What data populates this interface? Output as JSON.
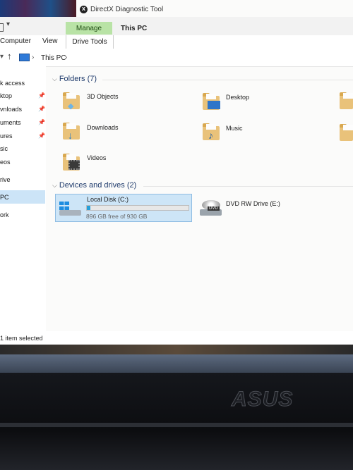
{
  "window": {
    "title": "DirectX Diagnostic Tool",
    "context_title": "This PC"
  },
  "ribbon": {
    "manage_tab": "Manage",
    "tabs": [
      "Computer",
      "View",
      "Drive Tools"
    ]
  },
  "address": {
    "breadcrumb": "This PC"
  },
  "nav_pane": {
    "items": [
      {
        "label": "k access",
        "pinned": false
      },
      {
        "label": "ktop",
        "pinned": true
      },
      {
        "label": "vnloads",
        "pinned": true
      },
      {
        "label": "uments",
        "pinned": true
      },
      {
        "label": "ures",
        "pinned": true
      },
      {
        "label": "sic",
        "pinned": false
      },
      {
        "label": "eos",
        "pinned": false
      },
      {
        "label": "rive",
        "pinned": false
      },
      {
        "label": "PC",
        "pinned": false,
        "selected": true
      },
      {
        "label": "ork",
        "pinned": false
      }
    ]
  },
  "folders": {
    "header": "Folders (7)",
    "items": [
      {
        "name": "3D Objects",
        "icon": "3d-objects-folder-icon"
      },
      {
        "name": "Desktop",
        "icon": "desktop-folder-icon"
      },
      {
        "name": "Downloads",
        "icon": "downloads-folder-icon"
      },
      {
        "name": "Music",
        "icon": "music-folder-icon"
      },
      {
        "name": "Videos",
        "icon": "videos-folder-icon"
      }
    ]
  },
  "devices": {
    "header": "Devices and drives (2)",
    "items": [
      {
        "name": "Local Disk (C:)",
        "free_text": "896 GB free of 930 GB",
        "used_fraction": 0.0366,
        "selected": true
      },
      {
        "name": "DVD RW Drive (E:)",
        "icon_badge": "DVD"
      }
    ]
  },
  "status": {
    "text": "1 item selected"
  },
  "hardware": {
    "brand": "ASUS"
  },
  "colors": {
    "selection": "#cde5f7",
    "manage_tab": "#b9e3a6",
    "capacity_fill": "#26a0da",
    "folder": "#e9c27a"
  }
}
